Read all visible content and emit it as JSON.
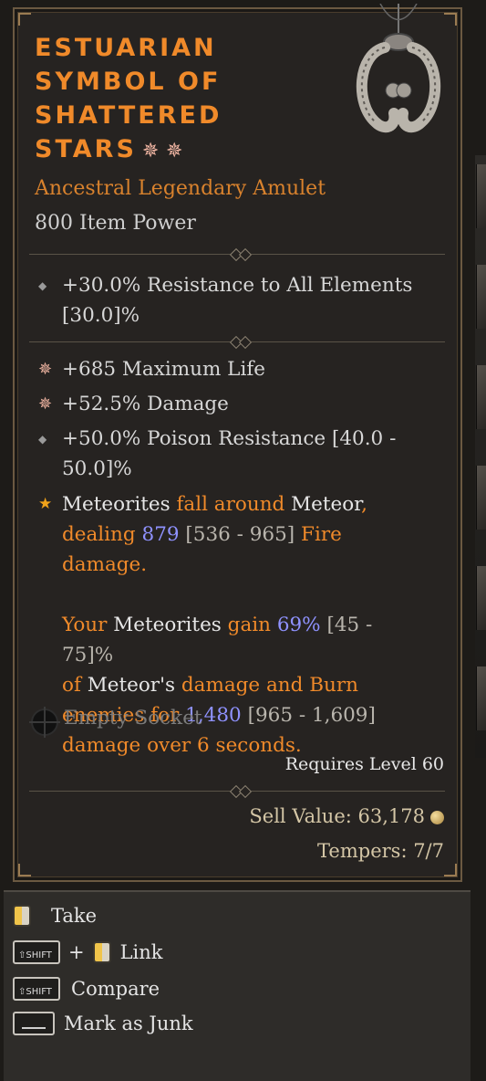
{
  "item": {
    "name_lines": [
      "Estuarian",
      "Symbol of",
      "Shattered",
      "Stars"
    ],
    "name_suffix_glyphs": "✵ ✵",
    "type": "Ancestral Legendary Amulet",
    "item_power": "800 Item Power"
  },
  "implicit": {
    "text": "+30.0% Resistance to All Elements",
    "range": "[30.0]%"
  },
  "affixes": [
    {
      "icon": "greater-affix-icon",
      "text": "+685 Maximum Life"
    },
    {
      "icon": "greater-affix-icon",
      "text": "+52.5% Damage"
    },
    {
      "icon": "affix-diamond-icon",
      "text": "+50.0% Poison Resistance [40.0 - 50.0]%"
    }
  ],
  "aspect": {
    "p1": [
      "Meteorites",
      " fall around ",
      "Meteor",
      ",",
      "dealing ",
      "879",
      " [536 - 965]",
      " Fire damage."
    ],
    "p2": [
      "Your ",
      "Meteorites",
      " gain ",
      "69%",
      " [45 - 75]%",
      "of ",
      "Meteor's",
      " damage and Burn",
      "enemies for ",
      "1,480",
      " [965 - 1,609]",
      "damage over 6 seconds."
    ]
  },
  "socket": "Empty Socket",
  "requires_level": "Requires Level 60",
  "sell_value": "Sell Value: 63,178",
  "tempers": "Tempers: 7/7",
  "actions": {
    "take": "Take",
    "link": "Link",
    "compare": "Compare",
    "junk": "Mark as Junk",
    "shift_key": "SHIFT",
    "plus": "+"
  },
  "colors": {
    "legendary": "#f08a2a",
    "value_blue": "#8f92ff",
    "background": "#262321"
  }
}
